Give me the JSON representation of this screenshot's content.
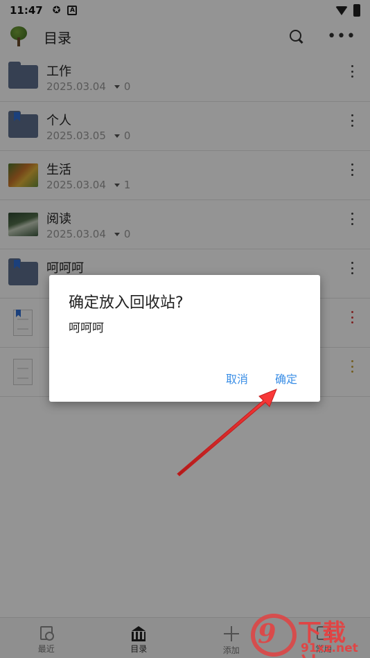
{
  "status_bar": {
    "time": "11:47"
  },
  "app_bar": {
    "title": "目录"
  },
  "list": [
    {
      "title": "工作",
      "date": "2025.03.04",
      "count": "0",
      "thumb": "folder-icon"
    },
    {
      "title": "个人",
      "date": "2025.03.05",
      "count": "0",
      "thumb": "bookmarked-folder-icon"
    },
    {
      "title": "生活",
      "date": "2025.03.04",
      "count": "1",
      "thumb": "fruit-photo"
    },
    {
      "title": "阅读",
      "date": "2025.03.04",
      "count": "0",
      "thumb": "reading-photo"
    },
    {
      "title": "呵呵呵",
      "date": "",
      "count": "",
      "thumb": "bookmarked-folder-icon"
    },
    {
      "title": "",
      "date": "",
      "count": "",
      "thumb": "bookmarked-document-icon"
    },
    {
      "title": "",
      "date": "",
      "count": "",
      "thumb": "document-icon"
    }
  ],
  "dialog": {
    "title": "确定放入回收站?",
    "message": "呵呵呵",
    "cancel_label": "取消",
    "ok_label": "确定"
  },
  "bottom_nav": [
    {
      "label": "最近",
      "icon": "recent-icon"
    },
    {
      "label": "目录",
      "icon": "directory-icon"
    },
    {
      "label": "添加",
      "icon": "add-icon"
    },
    {
      "label": "常用",
      "icon": "common-icon"
    }
  ],
  "watermark": {
    "brand": "下载站",
    "url": "91xz.net"
  },
  "colors": {
    "accent": "#3a8ee6",
    "annotation_arrow": "#e02a2a",
    "folder": "#5e6f8d"
  }
}
